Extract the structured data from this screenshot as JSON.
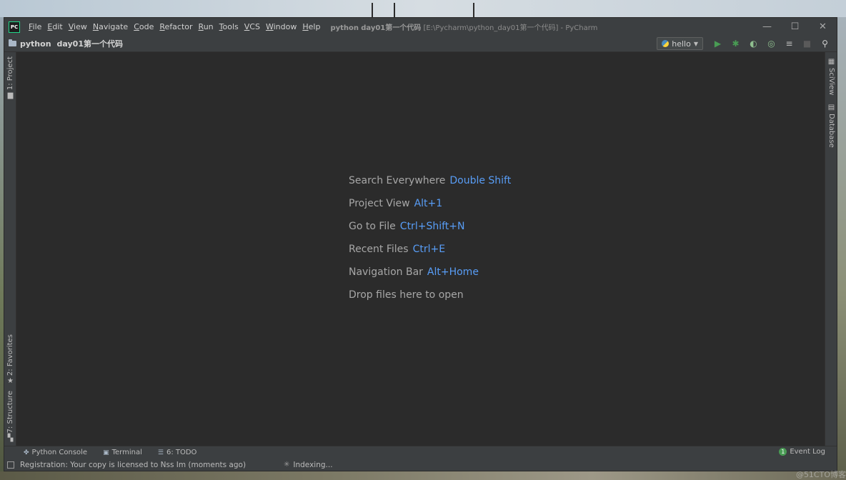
{
  "window": {
    "app_logo": "PC",
    "title_project": "python",
    "title_path": "day01第一个代码",
    "title_suffix": "[E:\\Pycharm\\python_day01第一个代码] - PyCharm",
    "controls": {
      "minimize": "—",
      "maximize": "☐",
      "close": "✕"
    }
  },
  "menu": [
    {
      "mnemonic": "F",
      "rest": "ile"
    },
    {
      "mnemonic": "E",
      "rest": "dit"
    },
    {
      "mnemonic": "V",
      "rest": "iew"
    },
    {
      "mnemonic": "N",
      "rest": "avigate"
    },
    {
      "mnemonic": "C",
      "rest": "ode"
    },
    {
      "mnemonic": "R",
      "rest": "efactor"
    },
    {
      "mnemonic": "R",
      "rest": "un"
    },
    {
      "mnemonic": "T",
      "rest": "ools"
    },
    {
      "mnemonic": "V",
      "rest": "CS"
    },
    {
      "mnemonic": "W",
      "rest": "indow"
    },
    {
      "mnemonic": "H",
      "rest": "elp"
    }
  ],
  "breadcrumb": {
    "project": "python",
    "folder": "day01第一个代码"
  },
  "toolbar": {
    "run_config": "hello",
    "icons": [
      "run-icon",
      "debug-icon",
      "coverage-icon",
      "profile-icon",
      "concurrency-icon",
      "stop-icon",
      "search-everywhere-icon"
    ],
    "run_color": "#499c54"
  },
  "left_tool_windows": [
    {
      "label": "1: Project",
      "icon": "folder-icon"
    },
    {
      "label": "2: Favorites",
      "icon": "star-icon"
    },
    {
      "label": "7: Structure",
      "icon": "structure-icon"
    }
  ],
  "right_tool_windows": [
    {
      "label": "SciView",
      "icon": "sciview-icon"
    },
    {
      "label": "Database",
      "icon": "database-icon"
    }
  ],
  "editor_hints": [
    {
      "label": "Search Everywhere",
      "shortcut": "Double Shift"
    },
    {
      "label": "Project View",
      "shortcut": "Alt+1"
    },
    {
      "label": "Go to File",
      "shortcut": "Ctrl+Shift+N"
    },
    {
      "label": "Recent Files",
      "shortcut": "Ctrl+E"
    },
    {
      "label": "Navigation Bar",
      "shortcut": "Alt+Home"
    },
    {
      "label": "Drop files here to open",
      "shortcut": ""
    }
  ],
  "tool_tabs": [
    {
      "label": "Python Console",
      "icon": "python-console-icon"
    },
    {
      "label": "Terminal",
      "icon": "terminal-icon"
    },
    {
      "label": "6: TODO",
      "icon": "todo-icon"
    }
  ],
  "event_log": {
    "label": "Event Log",
    "count": "1"
  },
  "status": {
    "message": "Registration: Your copy is licensed to Nss Im (moments ago)",
    "indexing": "Indexing..."
  },
  "watermark": "@51CTO博客",
  "colors": {
    "accent": "#589df6",
    "editor_bg": "#2b2b2b",
    "chrome_bg": "#3c3f41"
  }
}
